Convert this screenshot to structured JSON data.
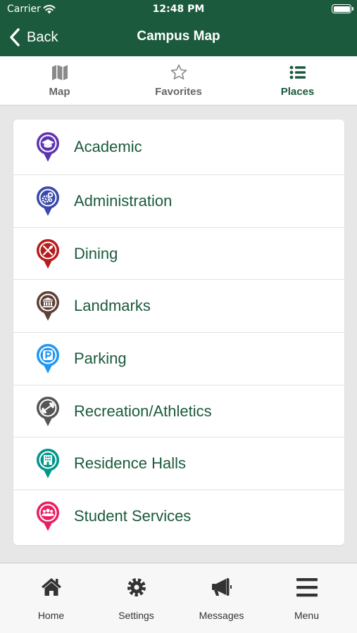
{
  "status_bar": {
    "carrier": "Carrier",
    "time": "12:48 PM"
  },
  "nav": {
    "back_label": "Back",
    "title": "Campus Map"
  },
  "tabs": [
    {
      "label": "Map",
      "icon": "map-icon",
      "active": false
    },
    {
      "label": "Favorites",
      "icon": "star-outline-icon",
      "active": false
    },
    {
      "label": "Places",
      "icon": "list-icon",
      "active": true
    }
  ],
  "places": [
    {
      "label": "Academic",
      "icon": "graduation-cap-icon",
      "color": "#5e35b1"
    },
    {
      "label": "Administration",
      "icon": "gears-icon",
      "color": "#3949ab"
    },
    {
      "label": "Dining",
      "icon": "utensils-icon",
      "color": "#b71c1c"
    },
    {
      "label": "Landmarks",
      "icon": "landmark-icon",
      "color": "#5d4037"
    },
    {
      "label": "Parking",
      "icon": "parking-icon",
      "color": "#2196f3"
    },
    {
      "label": "Recreation/Athletics",
      "icon": "dumbbell-icon",
      "color": "#555555"
    },
    {
      "label": "Residence Halls",
      "icon": "building-icon",
      "color": "#009688"
    },
    {
      "label": "Student Services",
      "icon": "users-icon",
      "color": "#e91e63"
    }
  ],
  "bottom_nav": [
    {
      "label": "Home",
      "icon": "home-icon"
    },
    {
      "label": "Settings",
      "icon": "gear-icon"
    },
    {
      "label": "Messages",
      "icon": "megaphone-icon"
    },
    {
      "label": "Menu",
      "icon": "hamburger-icon"
    }
  ],
  "colors": {
    "brand": "#1b5a3c",
    "background": "#e7e7e7"
  }
}
